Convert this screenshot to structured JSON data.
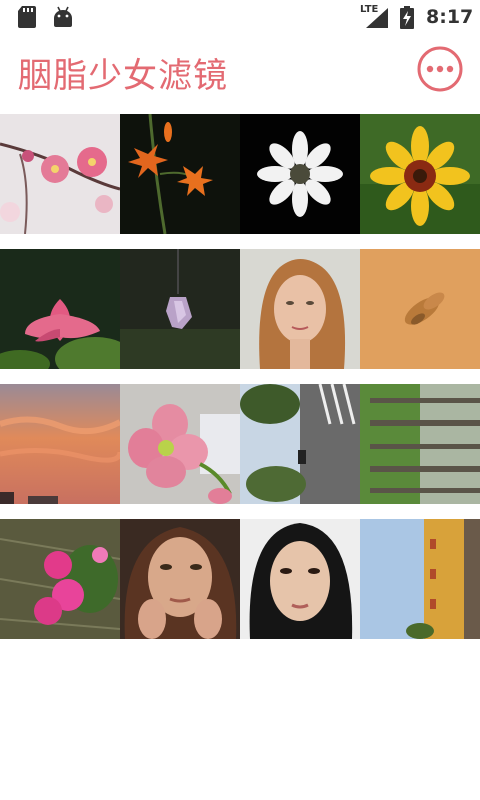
{
  "status_bar": {
    "network_type": "LTE",
    "time": "8:17",
    "icons": [
      "sd-card-icon",
      "android-icon",
      "signal-icon",
      "battery-charging-icon"
    ]
  },
  "app_bar": {
    "title": "胭脂少女滤镜",
    "more_icon": "more-options-icon"
  },
  "gallery": {
    "rows": [
      [
        "plum-blossom",
        "tiger-lily",
        "white-chrysanthemum",
        "yellow-sunflower"
      ],
      [
        "pink-lotus",
        "crystal-pendant",
        "woman-portrait-red-hair",
        "moth-on-sand"
      ],
      [
        "sunset-clouds",
        "pink-flower-closeup",
        "tree-lined-road",
        "forest-trees-rotated"
      ],
      [
        "pink-geraniums",
        "freckled-woman-portrait",
        "dark-hair-woman-portrait",
        "palace-building-rotated"
      ]
    ]
  },
  "colors": {
    "accent": "#e36a72",
    "background": "#ffffff"
  }
}
